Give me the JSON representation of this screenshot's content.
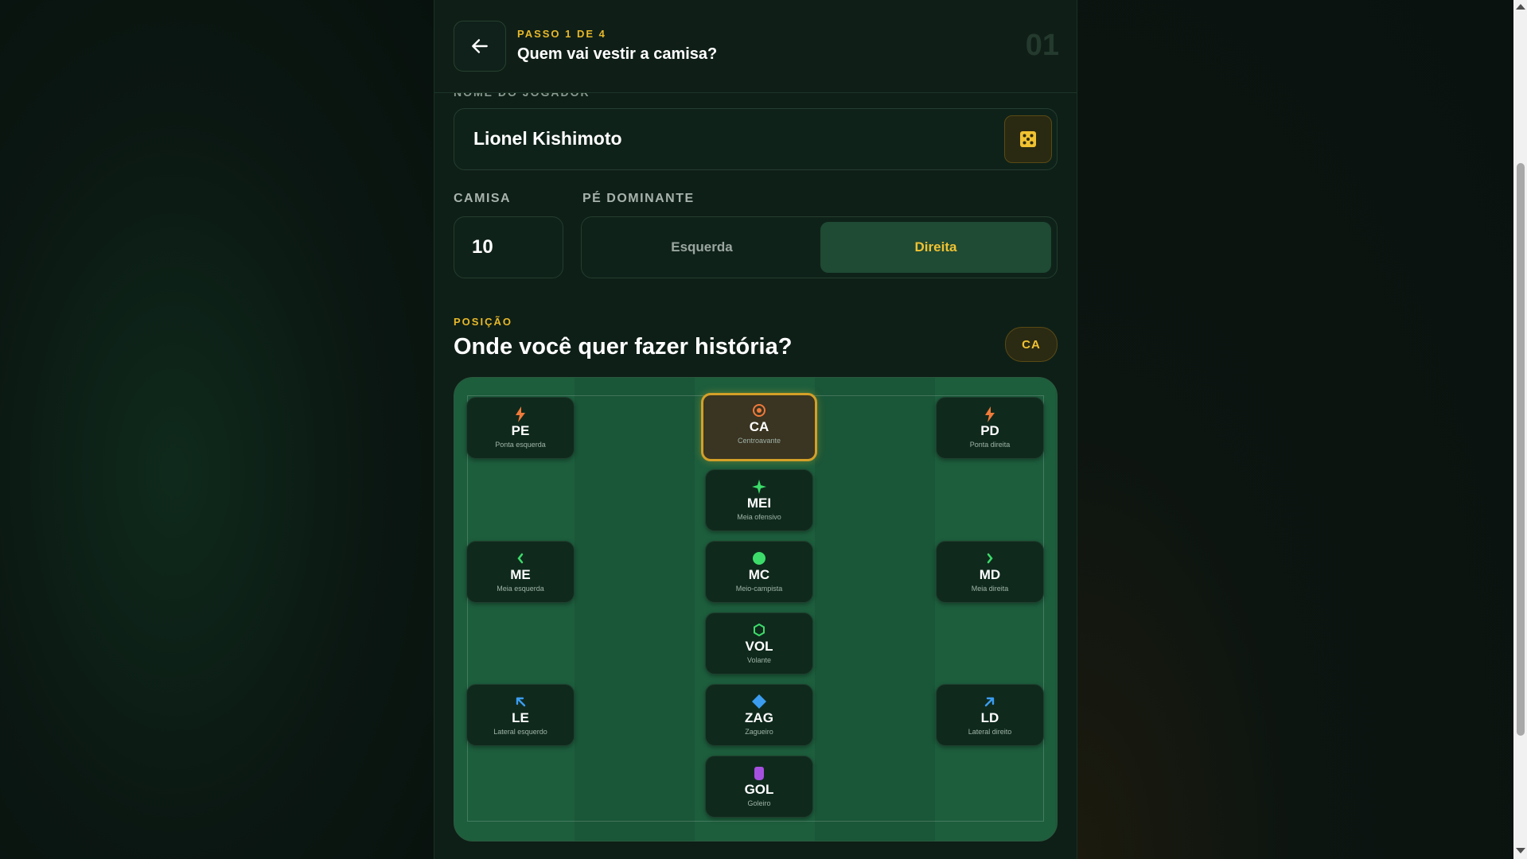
{
  "header": {
    "step_label": "PASSO 1 DE 4",
    "question": "Quem vai vestir a camisa?",
    "step_number": "01"
  },
  "name_field": {
    "label": "NOME DO JOGADOR",
    "value": "Lionel Kishimoto",
    "randomize_icon": "dice-icon"
  },
  "jersey": {
    "label": "CAMISA",
    "value": "10"
  },
  "dominant_foot": {
    "label": "PÉ DOMINANTE",
    "options": [
      "Esquerda",
      "Direita"
    ],
    "selected": "Direita"
  },
  "position": {
    "label": "POSIÇÃO",
    "title": "Onde você quer fazer história?",
    "selected_badge": "CA",
    "cards": [
      {
        "abbr": "PE",
        "desc": "Ponta esquerda",
        "icon": "lightning-icon",
        "color": "#f07a3a"
      },
      {
        "abbr": "CA",
        "desc": "Centroavante",
        "icon": "target-icon",
        "color": "#f07a3a",
        "selected": true
      },
      {
        "abbr": "PD",
        "desc": "Ponta direita",
        "icon": "lightning-icon",
        "color": "#f07a3a"
      },
      {
        "abbr": "MEI",
        "desc": "Meia ofensivo",
        "icon": "sparkle-icon",
        "color": "#3ddc6a"
      },
      {
        "abbr": "ME",
        "desc": "Meia esquerda",
        "icon": "chevron-left-icon",
        "color": "#3ddc6a"
      },
      {
        "abbr": "MC",
        "desc": "Meio-campista",
        "icon": "circle-icon",
        "color": "#3ddc6a"
      },
      {
        "abbr": "MD",
        "desc": "Meia direita",
        "icon": "chevron-right-icon",
        "color": "#3ddc6a"
      },
      {
        "abbr": "VOL",
        "desc": "Volante",
        "icon": "hexagon-icon",
        "color": "#3ddc6a"
      },
      {
        "abbr": "LE",
        "desc": "Lateral esquerdo",
        "icon": "arrow-up-left-icon",
        "color": "#3b9cf0"
      },
      {
        "abbr": "ZAG",
        "desc": "Zagueiro",
        "icon": "diamond-icon",
        "color": "#3b9cf0"
      },
      {
        "abbr": "LD",
        "desc": "Lateral direito",
        "icon": "arrow-up-right-icon",
        "color": "#3b9cf0"
      },
      {
        "abbr": "GOL",
        "desc": "Goleiro",
        "icon": "glove-icon",
        "color": "#a650e0"
      }
    ]
  }
}
